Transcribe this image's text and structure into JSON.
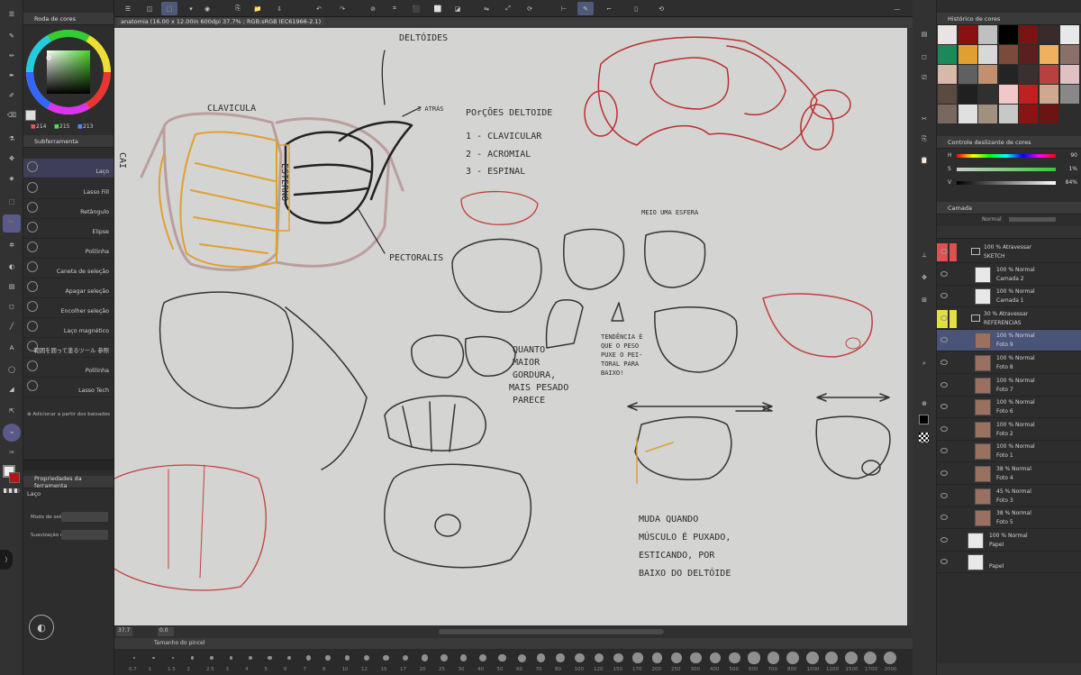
{
  "document_tab": "anatomia (16.00 x 12.00in 600dpi 37.7% ; RGB:sRGB IEC61966-2.1)",
  "color_wheel": {
    "title": "Roda de cores",
    "r": "214",
    "g": "215",
    "b": "213"
  },
  "subtool": {
    "title": "Subferramenta",
    "items": [
      "Laço",
      "Lasso Fill",
      "Retângulo",
      "Elipse",
      "Polilinha",
      "Caneta de seleção",
      "Apagar seleção",
      "Encolher seleção",
      "Laço magnético",
      "範囲を囲って塗るツール 参照",
      "Polilinha",
      "Lasso Tech"
    ],
    "add_label": "Adicionar a partir dos baixados"
  },
  "tool_props": {
    "title": "Propriedades da ferramenta",
    "tool_name": "Laço",
    "mode_label": "Modo de sele",
    "smoothing_label": "Suavização d"
  },
  "canvas_notes": {
    "deltoid_title": "POrÇÕES DELTOIDE",
    "deltoid_items": [
      "1 - CLAVICULAR",
      "2 - ACROMIAL",
      "3 - ESPINAL"
    ],
    "clavicula": "CLAVICULA",
    "deltoides": "DELTÓIDES",
    "atras": "3 ATRÁS",
    "esterno": "ESTERNO",
    "pectoralis": "PECTORALIS",
    "meio_esfera": "MEIO UMA ESFERA",
    "tendencia": [
      "TENDÊNCIA É",
      "QUE O PESO",
      "PUXE O PEI-",
      "TORAL PARA",
      "BAIXO!"
    ],
    "gordura": [
      "QUANTO",
      "MAIOR",
      "GORDURA,",
      "MAIS PESADO",
      "PARECE"
    ],
    "muda": [
      "MUDA QUANDO",
      "MÚSCULO É PUXADO,",
      "ESTICANDO, POR",
      "BAIXO DO DELTÓIDE"
    ],
    "cai": "CAI"
  },
  "status": {
    "zoom": "37.7",
    "angle": "0.0"
  },
  "brush_size": {
    "title": "Tamanho do pincel",
    "sizes": [
      "0.7",
      "1",
      "1.5",
      "2",
      "2.5",
      "3",
      "4",
      "5",
      "6",
      "7",
      "8",
      "10",
      "12",
      "15",
      "17",
      "20",
      "25",
      "30",
      "40",
      "50",
      "60",
      "70",
      "80",
      "100",
      "120",
      "150",
      "170",
      "200",
      "250",
      "300",
      "400",
      "500",
      "600",
      "700",
      "800",
      "1000",
      "1200",
      "1500",
      "1700",
      "2000"
    ]
  },
  "color_history": {
    "title": "Histórico de cores",
    "colors": [
      "#e8e4e4",
      "#8c1010",
      "#c0c0c0",
      "#000000",
      "#7a1414",
      "#3a2a2a",
      "#e8e8e8",
      "#1a8a5a",
      "#e0a030",
      "#d8d8d8",
      "#7a4a3a",
      "#5a2020",
      "#f0b060",
      "#8a7068",
      "#d8b8a8",
      "#606060",
      "#c09070",
      "#242424",
      "#3a3030",
      "#b84040",
      "#e0c0c0",
      "#5a4a40",
      "#202020",
      "#303030",
      "#f0c8c8",
      "#c02020",
      "#d0a890",
      "#888888",
      "#786860",
      "#e0e0e0",
      "#a09080",
      "#c8c8c8",
      "#8a1414",
      "#6a1414"
    ]
  },
  "color_slider": {
    "title": "Controle deslizante de cores",
    "h": "90",
    "s": "1%",
    "v": "84%"
  },
  "layers": {
    "title": "Camada",
    "blend_mode": "Normal",
    "items": [
      {
        "blend": "100 % Atravessar",
        "name": "SKETCH",
        "folder": true
      },
      {
        "blend": "100 % Normal",
        "name": "Camada 2"
      },
      {
        "blend": "100 % Normal",
        "name": "Camada 1"
      },
      {
        "blend": "30 % Atravessar",
        "name": "REFERENCIAS",
        "folder": true
      },
      {
        "blend": "100 % Normal",
        "name": "Foto 9"
      },
      {
        "blend": "100 % Normal",
        "name": "Foto 8"
      },
      {
        "blend": "100 % Normal",
        "name": "Foto 7"
      },
      {
        "blend": "100 % Normal",
        "name": "Foto 6"
      },
      {
        "blend": "100 % Normal",
        "name": "Foto 2"
      },
      {
        "blend": "100 % Normal",
        "name": "Foto 1"
      },
      {
        "blend": "38 % Normal",
        "name": "Foto 4"
      },
      {
        "blend": "45 % Normal",
        "name": "Foto 3"
      },
      {
        "blend": "38 % Normal",
        "name": "Foto 5"
      },
      {
        "blend": "100 % Normal",
        "name": "Papel"
      },
      {
        "blend": "",
        "name": "Papel"
      }
    ]
  },
  "colors": {
    "accent": "#5a5a8a",
    "selection": "#4a5478",
    "red_flag": "#e05050",
    "yellow_flag": "#e0e040"
  }
}
